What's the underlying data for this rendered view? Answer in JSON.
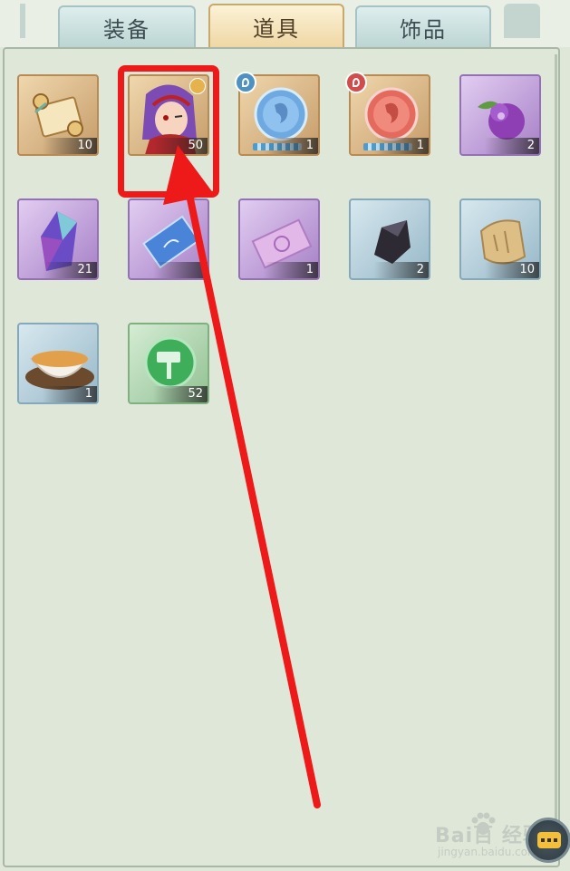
{
  "tabs": [
    {
      "label": "装备",
      "active": false
    },
    {
      "label": "道具",
      "active": true
    },
    {
      "label": "饰品",
      "active": false
    }
  ],
  "items": [
    {
      "icon": "scroll-icon",
      "count": "10",
      "frame": "gold"
    },
    {
      "icon": "hero-shard-icon",
      "count": "50",
      "frame": "gold"
    },
    {
      "icon": "water-orb-icon",
      "count": "1",
      "frame": "gold"
    },
    {
      "icon": "fire-orb-icon",
      "count": "1",
      "frame": "gold"
    },
    {
      "icon": "purple-fruit-icon",
      "count": "2",
      "frame": "purple"
    },
    {
      "icon": "crystal-icon",
      "count": "21",
      "frame": "purple"
    },
    {
      "icon": "blue-talisman-icon",
      "count": "",
      "frame": "purple"
    },
    {
      "icon": "purple-talisman-icon",
      "count": "1",
      "frame": "purple"
    },
    {
      "icon": "dark-stone-icon",
      "count": "2",
      "frame": "blue"
    },
    {
      "icon": "cloth-bag-icon",
      "count": "10",
      "frame": "blue"
    },
    {
      "icon": "tea-bowl-icon",
      "count": "1",
      "frame": "blue"
    },
    {
      "icon": "green-hammer-coin-icon",
      "count": "52",
      "frame": "green"
    }
  ],
  "watermark": {
    "brand": "Bai百 经验",
    "url": "jingyan.baidu.com"
  },
  "colors": {
    "highlight": "#ee1a1a",
    "panel": "#dfe8d8",
    "active_tab": "#efd7a5"
  }
}
